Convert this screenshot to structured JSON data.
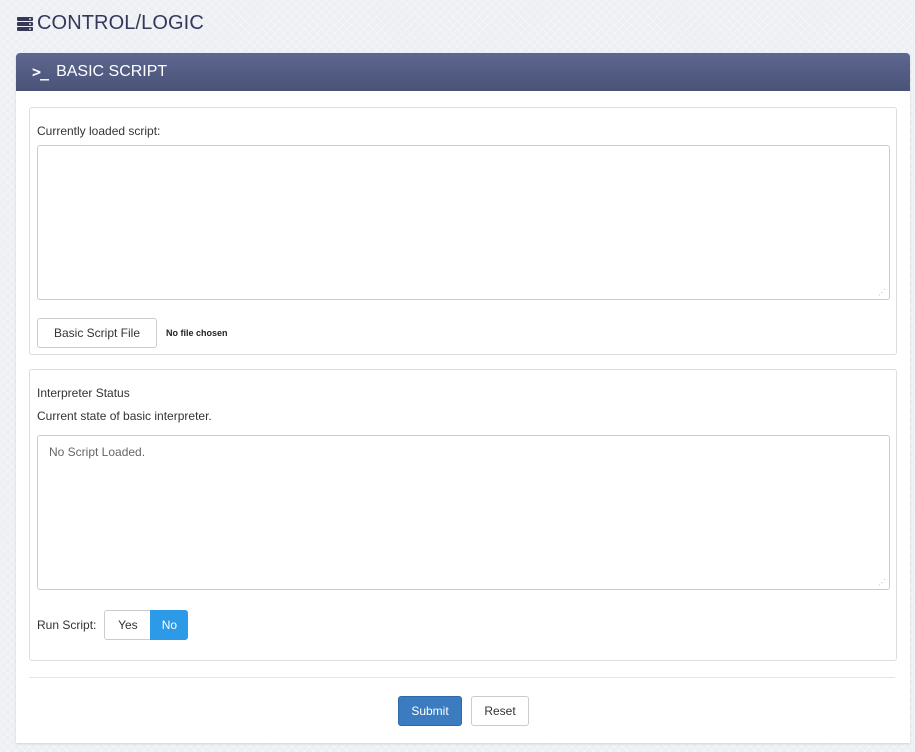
{
  "header": {
    "title": "CONTROL/LOGIC",
    "icon": "server-stack-icon"
  },
  "panel": {
    "heading": "BASIC SCRIPT",
    "heading_icon": "terminal-icon",
    "accent": "#4f5a80"
  },
  "script_section": {
    "label": "Currently loaded script:",
    "textarea_value": "",
    "file_button_label": "Basic Script File",
    "file_status": "No file chosen"
  },
  "interpreter_section": {
    "title": "Interpreter Status",
    "description": "Current state of basic interpreter.",
    "status_value": "No Script Loaded."
  },
  "run_script": {
    "label": "Run Script:",
    "options": [
      "Yes",
      "No"
    ],
    "selected": "No",
    "selected_color": "#2d9ae8"
  },
  "actions": {
    "submit_label": "Submit",
    "reset_label": "Reset",
    "submit_color": "#3b7bbf"
  }
}
